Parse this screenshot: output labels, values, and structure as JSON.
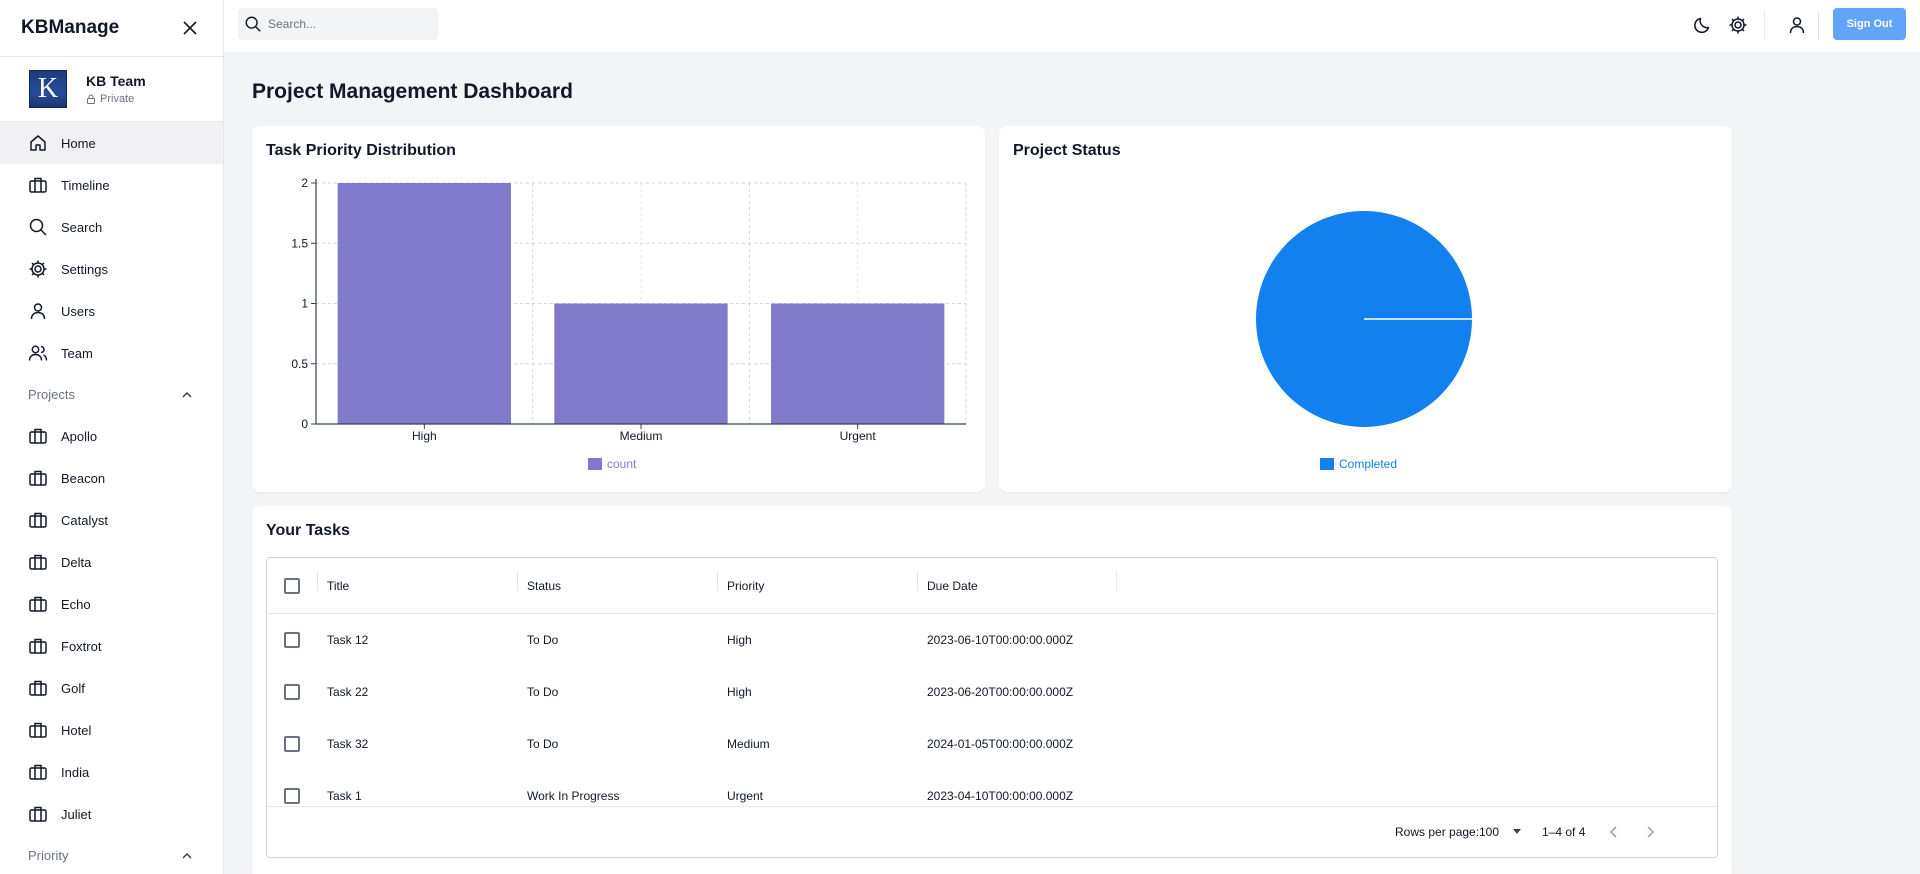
{
  "sidebar": {
    "brand": "KBManage",
    "team": {
      "name": "KB Team",
      "visibility": "Private",
      "logo_letter": "K"
    },
    "nav": [
      {
        "label": "Home",
        "icon": "home-icon",
        "active": true
      },
      {
        "label": "Timeline",
        "icon": "briefcase-icon"
      },
      {
        "label": "Search",
        "icon": "search-icon"
      },
      {
        "label": "Settings",
        "icon": "gear-icon"
      },
      {
        "label": "Users",
        "icon": "user-icon"
      },
      {
        "label": "Team",
        "icon": "users-icon"
      }
    ],
    "projects_label": "Projects",
    "projects": [
      "Apollo",
      "Beacon",
      "Catalyst",
      "Delta",
      "Echo",
      "Foxtrot",
      "Golf",
      "Hotel",
      "India",
      "Juliet"
    ],
    "priority_label": "Priority"
  },
  "topbar": {
    "search_placeholder": "Search...",
    "icons": [
      "moon-icon",
      "gear-icon",
      "user-icon"
    ],
    "signout_label": "Sign Out",
    "accent": "#60a5fa"
  },
  "page_title": "Project Management Dashboard",
  "priority_card": {
    "title": "Task Priority Distribution",
    "bar_color": "#8079cc"
  },
  "status_card": {
    "title": "Project Status",
    "color": "#1380f0"
  },
  "chart_data": [
    {
      "type": "bar",
      "title": "Task Priority Distribution",
      "categories": [
        "High",
        "Medium",
        "Urgent"
      ],
      "series": [
        {
          "name": "count",
          "values": [
            2,
            1,
            1
          ]
        }
      ],
      "ylim": [
        0,
        2
      ],
      "yticks": [
        "0",
        "0.5",
        "1",
        "1.5",
        "2"
      ],
      "grid": true,
      "legend": "bottom"
    },
    {
      "type": "pie",
      "title": "Project Status",
      "labels": [
        "Completed"
      ],
      "values": [
        1
      ],
      "legend": "bottom"
    }
  ],
  "tasks": {
    "title": "Your Tasks",
    "columns": [
      "Title",
      "Status",
      "Priority",
      "Due Date"
    ],
    "rows": [
      [
        "Task 12",
        "To Do",
        "High",
        "2023-06-10T00:00:00.000Z"
      ],
      [
        "Task 22",
        "To Do",
        "High",
        "2023-06-20T00:00:00.000Z"
      ],
      [
        "Task 32",
        "To Do",
        "Medium",
        "2024-01-05T00:00:00.000Z"
      ],
      [
        "Task 1",
        "Work In Progress",
        "Urgent",
        "2023-04-10T00:00:00.000Z"
      ]
    ],
    "rows_per_page_label": "Rows per page:",
    "rows_per_page": "100",
    "range": "1–4 of 4"
  }
}
